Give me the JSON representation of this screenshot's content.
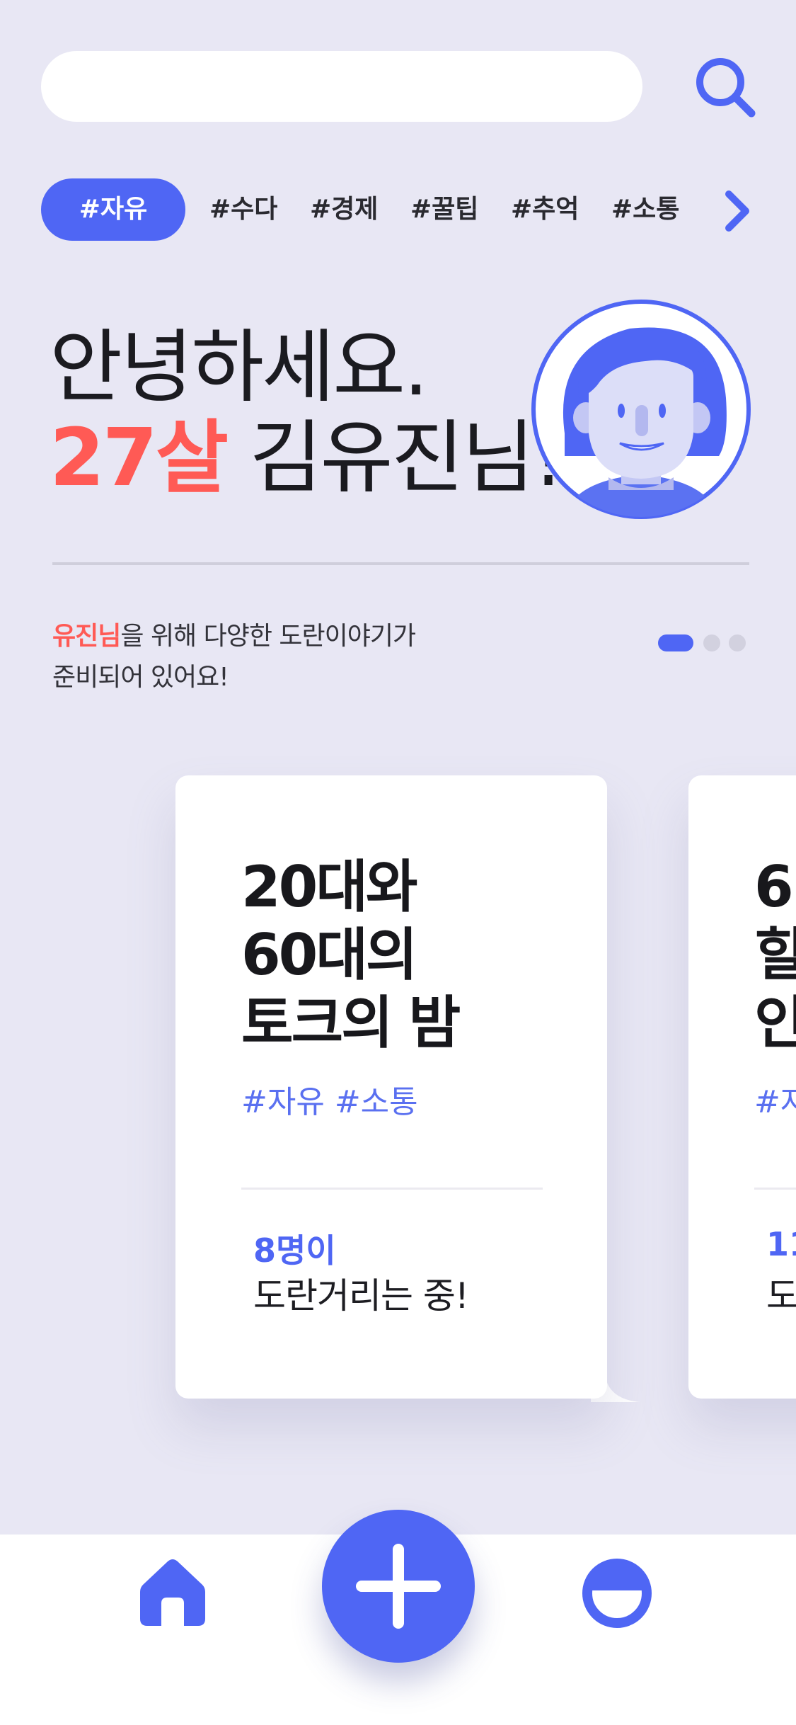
{
  "search": {
    "value": "",
    "placeholder": ""
  },
  "icons": {
    "search": "search-icon",
    "next": "chevron-right-icon",
    "home": "home-icon",
    "add": "plus-icon",
    "profile": "profile-icon"
  },
  "tags": [
    {
      "label": "#자유",
      "active": true
    },
    {
      "label": "#수다"
    },
    {
      "label": "#경제"
    },
    {
      "label": "#꿀팁"
    },
    {
      "label": "#추억"
    },
    {
      "label": "#소통"
    }
  ],
  "greeting": {
    "line1": "안녕하세요.",
    "age": "27살",
    "name": "김유진님!"
  },
  "intro": {
    "highlight": "유진님",
    "text1": "을 위해 다양한 도란이야기가",
    "text2": "준비되어 있어요!"
  },
  "carousel": {
    "page_count": 3,
    "current_page": 1
  },
  "cards": [
    {
      "title": "20대와\n60대의\n토크의 밤",
      "tags": "#자유 #소통",
      "count": "8명이",
      "status": "도란거리는 중!"
    },
    {
      "title": "6\n힐\n인",
      "tags": "#자",
      "count": "11",
      "status": "도"
    }
  ],
  "colors": {
    "background": "#e8e7f4",
    "accent": "#4f66f4",
    "highlight": "#ff5a55",
    "card": "#ffffff"
  }
}
